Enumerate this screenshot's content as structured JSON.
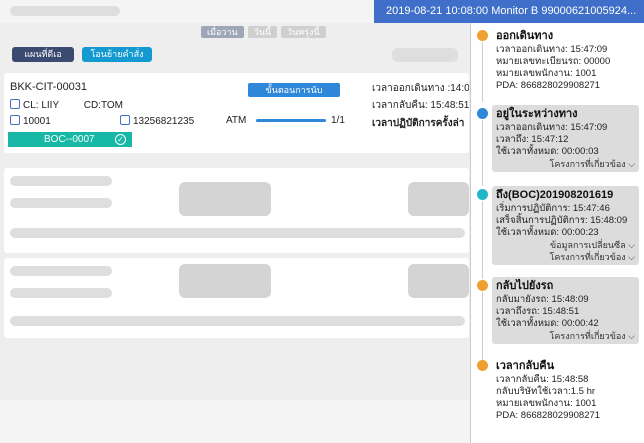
{
  "status_bar": {
    "text": "2019-08-21 10:08:00 Monitor B  99000621005924..."
  },
  "tabs": [
    {
      "label": "เมื่อวาน",
      "active": true
    },
    {
      "label": "วันนี้",
      "active": false
    },
    {
      "label": "วันพรุ่งนี้",
      "active": false
    }
  ],
  "actions": {
    "print_label": "แผนที่ดีเอ",
    "transfer_label": "โอนย้ายคำสั่ง"
  },
  "task": {
    "id": "BKK-CIT-00031",
    "stage_button": "ขั้นตอนการนับ",
    "cl": "CL: LIIY",
    "cd": "CD:TOM",
    "vehicle": "10001",
    "phone": "13256821235",
    "atm_label": "ATM",
    "atm_progress_text": "1/1",
    "atm_progress": 1.0,
    "departure": "เวลาออกเดินทาง :14:0",
    "return": "เวลากลับคืน: 15:48:51",
    "first_op": "เวลาปฏิบัติการครั้งล่า",
    "boc": "BOC--0007"
  },
  "timeline": [
    {
      "title": "ออกเดินทาง",
      "color": "orange",
      "rows": [
        "เวลาออกเดินทาง:   15:47:09",
        "หมายเลขทะเบียนรถ:  00000",
        "หมายเลขพนักงาน:   1001",
        "PDA: 866828029908271"
      ],
      "links": []
    },
    {
      "title": "อยู่ในระหว่างทาง",
      "color": "blue",
      "rows": [
        "เวลาออกเดินทาง:   15:47:09",
        "เวลาถึง:    15:47:12",
        "ใช้เวลาทั้งหมด:    00:00:03"
      ],
      "links": [
        "โครงการที่เกี่ยวข้อง ⌵"
      ]
    },
    {
      "title": "ถึง(BOC)201908201619",
      "color": "teal",
      "rows": [
        "เริ่มการปฏิบัติการ:   15:47:46",
        "เสร็จสิ้นการปฏิบัติการ:  15:48:09",
        "ใช้เวลาทั้งหมด:    00:00:23"
      ],
      "links": [
        "ข้อมูลการเปลี่ยนซีล ⌵",
        "โครงการที่เกี่ยวข้อง ⌵"
      ]
    },
    {
      "title": "กลับไปยังรถ",
      "color": "orange",
      "rows": [
        "กลับมายังรถ:   15:48:09",
        "เวลาถึงรถ:    15:48:51",
        "ใช้เวลาทั้งหมด:    00:00:42"
      ],
      "links": [
        "โครงการที่เกี่ยวข้อง ⌵"
      ]
    },
    {
      "title": "เวลากลับคืน",
      "color": "orange",
      "rows": [
        "เวลากลับคืน:   15:48:58",
        "กลับบริษัทใช้เวลา:1.5 hr",
        "หมายเลขพนักงาน:  1001",
        "PDA: 866828029908271"
      ],
      "links": []
    }
  ]
}
